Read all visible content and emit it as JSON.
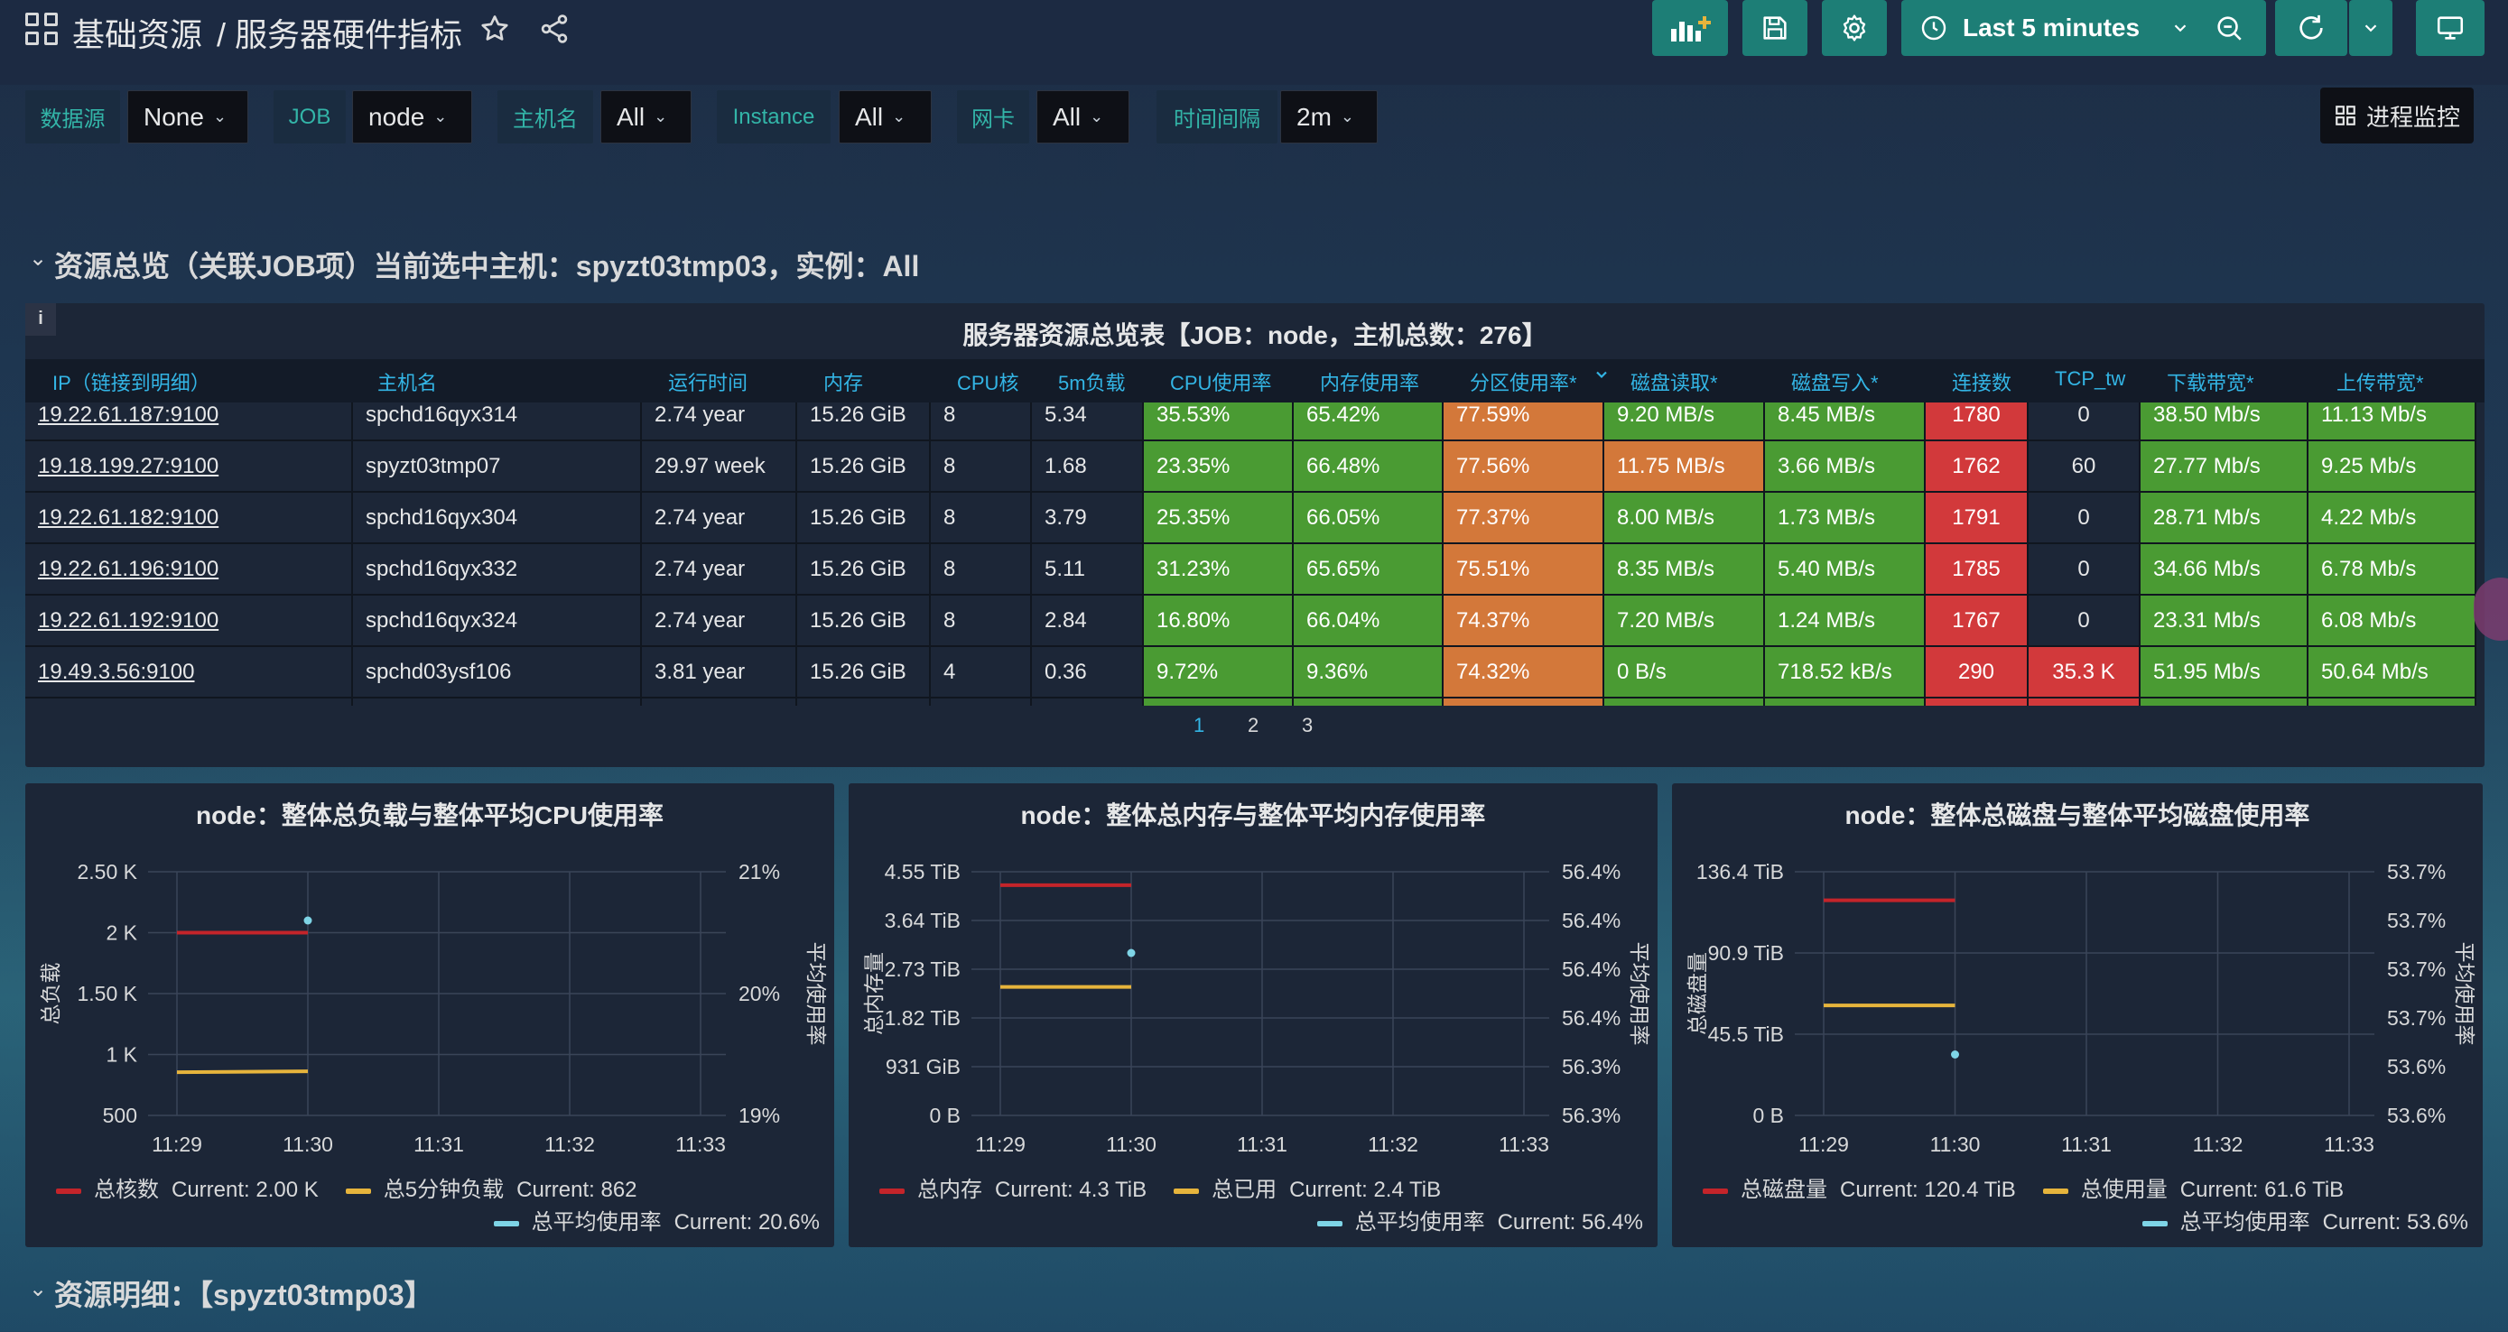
{
  "header": {
    "folder": "基础资源",
    "title": "/ 服务器硬件指标",
    "time_range": "Last 5 minutes"
  },
  "variables": [
    {
      "label": "数据源",
      "value": "None"
    },
    {
      "label": "JOB",
      "value": "node"
    },
    {
      "label": "主机名",
      "value": "All"
    },
    {
      "label": "Instance",
      "value": "All"
    },
    {
      "label": "网卡",
      "value": "All"
    },
    {
      "label": "时间间隔",
      "value": "2m"
    }
  ],
  "process_link": "进程监控",
  "row1_title": "资源总览（关联JOB项）当前选中主机：spyzt03tmp03，实例：All",
  "row2_title": "资源明细：【spyzt03tmp03】",
  "table": {
    "title": "服务器资源总览表【JOB：node，主机总数：276】",
    "info": "i",
    "columns": [
      "IP（链接到明细）",
      "主机名",
      "运行时间",
      "内存",
      "CPU核",
      "5m负载",
      "CPU使用率",
      "内存使用率",
      "分区使用率*",
      "磁盘读取*",
      "磁盘写入*",
      "连接数",
      "TCP_tw",
      "下载带宽*",
      "上传带宽*"
    ],
    "rows": [
      [
        "19.22.61.187:9100",
        "spchd16qyx314",
        "2.74 year",
        "15.26 GiB",
        "8",
        "5.34",
        "35.53%",
        "65.42%",
        "77.59%",
        "9.20 MB/s",
        "8.45 MB/s",
        "1780",
        "0",
        "38.50 Mb/s",
        "11.13 Mb/s"
      ],
      [
        "19.18.199.27:9100",
        "spyzt03tmp07",
        "29.97 week",
        "15.26 GiB",
        "8",
        "1.68",
        "23.35%",
        "66.48%",
        "77.56%",
        "11.75 MB/s",
        "3.66 MB/s",
        "1762",
        "60",
        "27.77 Mb/s",
        "9.25 Mb/s"
      ],
      [
        "19.22.61.182:9100",
        "spchd16qyx304",
        "2.74 year",
        "15.26 GiB",
        "8",
        "3.79",
        "25.35%",
        "66.05%",
        "77.37%",
        "8.00 MB/s",
        "1.73 MB/s",
        "1791",
        "0",
        "28.71 Mb/s",
        "4.22 Mb/s"
      ],
      [
        "19.22.61.196:9100",
        "spchd16qyx332",
        "2.74 year",
        "15.26 GiB",
        "8",
        "5.11",
        "31.23%",
        "65.65%",
        "75.51%",
        "8.35 MB/s",
        "5.40 MB/s",
        "1785",
        "0",
        "34.66 Mb/s",
        "6.78 Mb/s"
      ],
      [
        "19.22.61.192:9100",
        "spchd16qyx324",
        "2.74 year",
        "15.26 GiB",
        "8",
        "2.84",
        "16.80%",
        "66.04%",
        "74.37%",
        "7.20 MB/s",
        "1.24 MB/s",
        "1767",
        "0",
        "23.31 Mb/s",
        "6.08 Mb/s"
      ],
      [
        "19.49.3.56:9100",
        "spchd03ysf106",
        "3.81 year",
        "15.26 GiB",
        "4",
        "0.36",
        "9.72%",
        "9.36%",
        "74.32%",
        "0 B/s",
        "718.52 kB/s",
        "290",
        "35.3 K",
        "51.95 Mb/s",
        "50.64 Mb/s"
      ]
    ],
    "pages": [
      "1",
      "2",
      "3"
    ],
    "current_page": "1"
  },
  "colors": {
    "green": "#4a9b33",
    "orange": "#d3783a",
    "red": "#d2393b",
    "series_red": "#c4242a",
    "series_yellow": "#e6b43c",
    "series_cyan": "#7ed4e6",
    "accent": "#1d7e76"
  },
  "chart_data": [
    {
      "type": "line",
      "title": "node：整体总负载与整体平均CPU使用率",
      "ylabel": "总负载",
      "y2label": "平均使用率",
      "x": [
        "11:29",
        "11:30",
        "11:31",
        "11:32",
        "11:33"
      ],
      "y_ticks": [
        "2.50 K",
        "2 K",
        "1.50 K",
        "1 K",
        "500"
      ],
      "y2_ticks": [
        "21%",
        "20%",
        "19%"
      ],
      "ylim": [
        500,
        2500
      ],
      "y2lim": [
        19,
        21
      ],
      "series": [
        {
          "name": "总核数",
          "axis": "left",
          "x": [
            "11:29",
            "11:30"
          ],
          "values": [
            2000,
            2000
          ],
          "current": "Current: 2.00 K"
        },
        {
          "name": "总5分钟负载",
          "axis": "left",
          "x": [
            "11:29",
            "11:30"
          ],
          "values": [
            855,
            862
          ],
          "current": "Current: 862"
        },
        {
          "name": "总平均使用率",
          "axis": "right",
          "x": [
            "11:30"
          ],
          "values": [
            20.6
          ],
          "current": "Current: 20.6%"
        }
      ]
    },
    {
      "type": "line",
      "title": "node：整体总内存与整体平均内存使用率",
      "ylabel": "总内存量",
      "y2label": "平均使用率",
      "x": [
        "11:29",
        "11:30",
        "11:31",
        "11:32",
        "11:33"
      ],
      "y_ticks": [
        "4.55 TiB",
        "3.64 TiB",
        "2.73 TiB",
        "1.82 TiB",
        "931 GiB",
        "0 B"
      ],
      "y2_ticks": [
        "56.4%",
        "56.4%",
        "56.4%",
        "56.4%",
        "56.3%",
        "56.3%"
      ],
      "ylim": [
        0,
        4.55
      ],
      "y2lim": [
        56.3,
        56.45
      ],
      "series": [
        {
          "name": "总内存",
          "axis": "left",
          "x": [
            "11:29",
            "11:30"
          ],
          "values": [
            4.3,
            4.3
          ],
          "current": "Current: 4.3 TiB"
        },
        {
          "name": "总已用",
          "axis": "left",
          "x": [
            "11:29",
            "11:30"
          ],
          "values": [
            2.4,
            2.4
          ],
          "current": "Current: 2.4 TiB"
        },
        {
          "name": "总平均使用率",
          "axis": "right",
          "x": [
            "11:30"
          ],
          "values": [
            56.4
          ],
          "current": "Current: 56.4%"
        }
      ]
    },
    {
      "type": "line",
      "title": "node：整体总磁盘与整体平均磁盘使用率",
      "ylabel": "总磁盘量",
      "y2label": "平均使用率",
      "x": [
        "11:29",
        "11:30",
        "11:31",
        "11:32",
        "11:33"
      ],
      "y_ticks": [
        "136.4 TiB",
        "90.9 TiB",
        "45.5 TiB",
        "0 B"
      ],
      "y2_ticks": [
        "53.7%",
        "53.7%",
        "53.7%",
        "53.7%",
        "53.6%",
        "53.6%"
      ],
      "ylim": [
        0,
        136.4
      ],
      "y2lim": [
        53.55,
        53.75
      ],
      "series": [
        {
          "name": "总磁盘量",
          "axis": "left",
          "x": [
            "11:29",
            "11:30"
          ],
          "values": [
            120.4,
            120.4
          ],
          "current": "Current: 120.4 TiB"
        },
        {
          "name": "总使用量",
          "axis": "left",
          "x": [
            "11:29",
            "11:30"
          ],
          "values": [
            61.6,
            61.6
          ],
          "current": "Current: 61.6 TiB"
        },
        {
          "name": "总平均使用率",
          "axis": "right",
          "x": [
            "11:30"
          ],
          "values": [
            53.6
          ],
          "current": "Current: 53.6%"
        }
      ]
    }
  ]
}
